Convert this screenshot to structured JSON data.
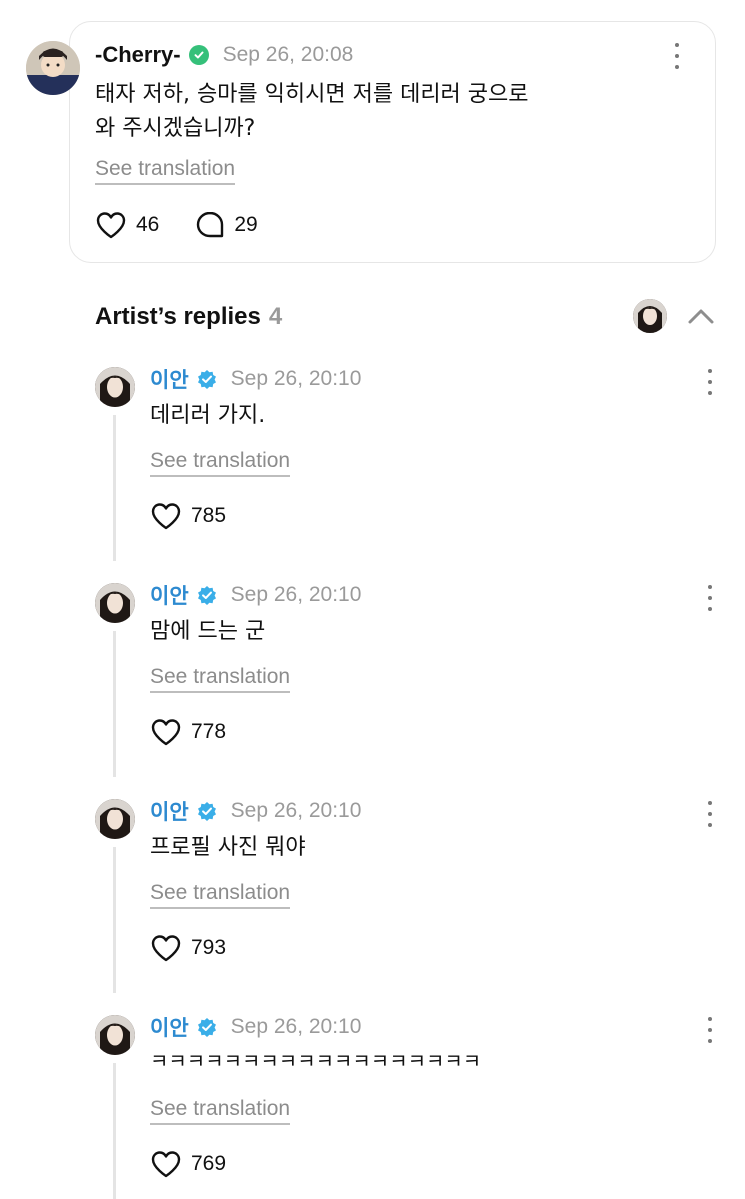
{
  "post": {
    "author": "-Cherry-",
    "timestamp": "Sep 26, 20:08",
    "text_line1": "태자 저하, 승마를 익히시면 저를 데리러 궁으로",
    "text_line2": "와 주시겠습니까?",
    "translate_label": "See translation",
    "likes": "46",
    "comments": "29"
  },
  "replies_header": {
    "title": "Artist’s replies",
    "count": "4"
  },
  "replies": [
    {
      "author": "이안",
      "timestamp": "Sep 26, 20:10",
      "text": "데리러 가지.",
      "translate_label": "See translation",
      "likes": "785"
    },
    {
      "author": "이안",
      "timestamp": "Sep 26, 20:10",
      "text": "맘에 드는 군",
      "translate_label": "See translation",
      "likes": "778"
    },
    {
      "author": "이안",
      "timestamp": "Sep 26, 20:10",
      "text": "프로필 사진 뭐야",
      "translate_label": "See translation",
      "likes": "793"
    },
    {
      "author": "이안",
      "timestamp": "Sep 26, 20:10",
      "text": "ㅋㅋㅋㅋㅋㅋㅋㅋㅋㅋㅋㅋㅋㅋㅋㅋㅋㅋ",
      "translate_label": "See translation",
      "likes": "769"
    }
  ],
  "colors": {
    "artist_name": "#2d8ad0",
    "artist_badge": "#3aaee8",
    "fan_badge": "#35c07a",
    "muted": "#9a9a9a"
  },
  "icons": {
    "like": "heart-outline-icon",
    "comment": "speech-bubble-icon",
    "more": "vertical-ellipsis-icon",
    "collapse": "chevron-up-icon",
    "verified": "verified-badge-icon"
  }
}
